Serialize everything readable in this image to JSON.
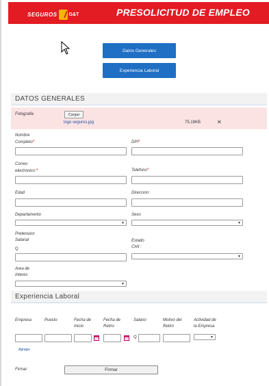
{
  "header": {
    "logo_text": "SEGUROS",
    "logo_sub": "G&T",
    "title": "PRESOLICITUD DE EMPLEO",
    "color": "#e31b23"
  },
  "nav": {
    "btn_datos": "Datos Generales",
    "btn_experiencia": "Experiencia Laboral",
    "color": "#1f6fc5"
  },
  "datos": {
    "section_title": "DATOS GENERALES",
    "photo_label": "Fotografia",
    "upload_label": "Cargar",
    "file_name": "logo seguros.jpg",
    "file_size": "75,19KB",
    "remove_icon": "✕",
    "nombre_label_1": "Nombre",
    "nombre_label_2": "Completo",
    "dpi_label": "DPI",
    "correo_label_1": "Correo",
    "correo_label_2": "electronico:",
    "telefono_label": "Telefono",
    "edad_label": "Edad",
    "direccion_label": "Direccion:",
    "departamento_label": "Departamento",
    "sexo_label": "Sexo",
    "pretension_label_1": "Pretension",
    "pretension_label_2": "Salarial",
    "currency": "Q",
    "estado_label_1": "Estado",
    "estado_label_2": "Civil :",
    "area_label_1": "Area de",
    "area_label_2": "Interes",
    "required_mark": "*"
  },
  "experiencia": {
    "section_title": "Experiencia Laboral",
    "col_empresa": "Empresa",
    "col_puesto": "Puesto",
    "col_fecha_inicio_1": "Fecha de",
    "col_fecha_inicio_2": "Inicio",
    "col_fecha_retiro_1": "Fecha de",
    "col_fecha_retiro_2": "Retiro",
    "col_salario": "Salario",
    "col_motivo_1": "Motivo del",
    "col_motivo_2": "Retiro",
    "col_actividad_1": "Actividad de",
    "col_actividad_2": "la Empresa",
    "currency": "Q",
    "add_link": "Agrega"
  },
  "firma": {
    "label": "Firmar",
    "button": "Firmar"
  }
}
